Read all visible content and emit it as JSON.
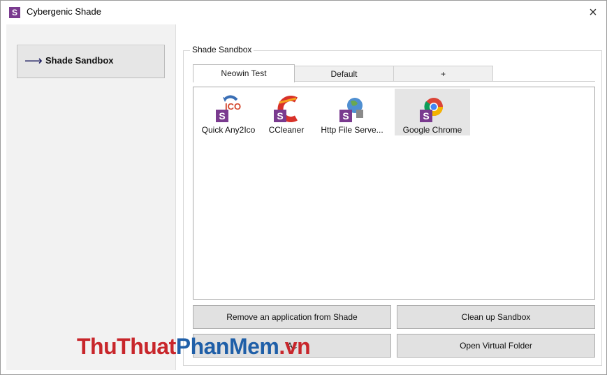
{
  "window": {
    "title": "Cybergenic Shade",
    "app_icon_letter": "S",
    "close_symbol": "×"
  },
  "sidebar": {
    "items": [
      {
        "label": "Shade Sandbox",
        "arrow": "⟶"
      }
    ]
  },
  "main": {
    "group_label": "Shade Sandbox",
    "tabs": [
      {
        "label": "Neowin Test",
        "active": true
      },
      {
        "label": "Default",
        "active": false
      },
      {
        "label": "+",
        "active": false
      }
    ],
    "apps": [
      {
        "label": "Quick Any2Ico",
        "icon": "any2ico-icon",
        "overlay_text": "ICO",
        "selected": false
      },
      {
        "label": "CCleaner",
        "icon": "ccleaner-icon",
        "selected": false
      },
      {
        "label": "Http File Serve...",
        "icon": "http-file-server-icon",
        "selected": false
      },
      {
        "label": "Google Chrome",
        "icon": "chrome-icon",
        "selected": true
      }
    ],
    "buttons": {
      "remove": "Remove an application from Shade",
      "cleanup": "Clean up Sandbox",
      "add": "Ac",
      "open_folder": "Open Virtual Folder"
    }
  },
  "watermark": {
    "part1": "ThuThuat",
    "part2": "PhanMem",
    "part3": ".vn"
  },
  "colors": {
    "shade_purple": "#7a3b8f",
    "watermark_red": "#c8262b",
    "watermark_blue": "#1f5fa8"
  }
}
